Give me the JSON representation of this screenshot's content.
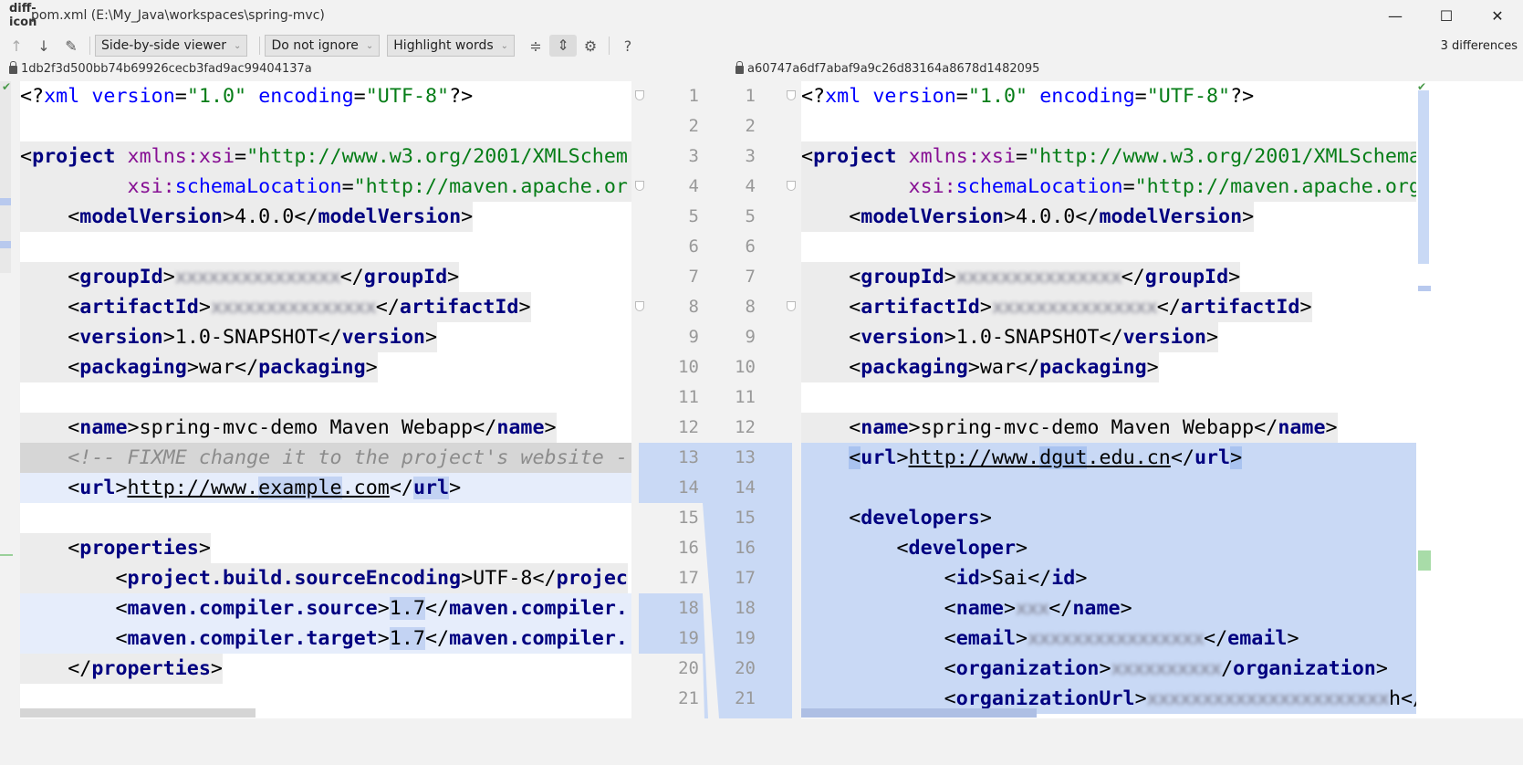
{
  "window": {
    "title": "pom.xml (E:\\My_Java\\workspaces\\spring-mvc)",
    "icon": "diff-icon",
    "minimize": "—",
    "maximize": "☐",
    "close": "✕"
  },
  "toolbar": {
    "prev_icon": "↑",
    "next_icon": "↓",
    "edit_icon": "✎",
    "viewer": "Side-by-side viewer",
    "ignore": "Do not ignore",
    "highlight": "Highlight words",
    "collapse_icon": "≑",
    "sync_scroll_icon": "⇕",
    "settings_icon": "⚙",
    "help_icon": "?",
    "differences": "3 differences"
  },
  "left": {
    "revision": "1db2f3d500bb74b69926cecb3fad9ac99404137a",
    "lines": [
      {
        "n": 1,
        "shade": "none",
        "segs": [
          [
            "p",
            "<?"
          ],
          [
            "a",
            "xml"
          ],
          [
            "p",
            " "
          ],
          [
            "a",
            "version"
          ],
          [
            "p",
            "="
          ],
          [
            "s",
            "\"1.0\""
          ],
          [
            "p",
            " "
          ],
          [
            "a",
            "encoding"
          ],
          [
            "p",
            "="
          ],
          [
            "s",
            "\"UTF-8\""
          ],
          [
            "p",
            "?>"
          ]
        ]
      },
      {
        "n": 2,
        "shade": "none",
        "segs": []
      },
      {
        "n": 3,
        "shade": "fullgray",
        "segs": [
          [
            "p",
            "<"
          ],
          [
            "t",
            "project"
          ],
          [
            "p",
            " "
          ],
          [
            "ns",
            "xmlns:xsi"
          ],
          [
            "p",
            "="
          ],
          [
            "s",
            "\"http://www.w3.org/2001/XMLSchem"
          ]
        ]
      },
      {
        "n": 4,
        "shade": "fullgray",
        "segs": [
          [
            "p",
            "         "
          ],
          [
            "ns",
            "xsi:"
          ],
          [
            "a",
            "schemaLocation"
          ],
          [
            "p",
            "="
          ],
          [
            "s",
            "\"http://maven.apache.or"
          ]
        ]
      },
      {
        "n": 5,
        "shade": "text",
        "segs": [
          [
            "p",
            "    <"
          ],
          [
            "t",
            "modelVersion"
          ],
          [
            "p",
            ">4.0.0</"
          ],
          [
            "t",
            "modelVersion"
          ],
          [
            "p",
            ">"
          ]
        ]
      },
      {
        "n": 6,
        "shade": "none",
        "segs": []
      },
      {
        "n": 7,
        "shade": "text",
        "segs": [
          [
            "p",
            "    <"
          ],
          [
            "t",
            "groupId"
          ],
          [
            "p",
            ">"
          ],
          [
            "b",
            "xxxxxxxxxxxxxxx"
          ],
          [
            "p",
            "</"
          ],
          [
            "t",
            "groupId"
          ],
          [
            "p",
            ">"
          ]
        ]
      },
      {
        "n": 8,
        "shade": "text",
        "segs": [
          [
            "p",
            "    <"
          ],
          [
            "t",
            "artifactId"
          ],
          [
            "p",
            ">"
          ],
          [
            "b",
            "xxxxxxxxxxxxxxx"
          ],
          [
            "p",
            "</"
          ],
          [
            "t",
            "artifactId"
          ],
          [
            "p",
            ">"
          ]
        ]
      },
      {
        "n": 9,
        "shade": "text",
        "segs": [
          [
            "p",
            "    <"
          ],
          [
            "t",
            "version"
          ],
          [
            "p",
            ">1.0-SNAPSHOT</"
          ],
          [
            "t",
            "version"
          ],
          [
            "p",
            ">"
          ]
        ]
      },
      {
        "n": 10,
        "shade": "text",
        "segs": [
          [
            "p",
            "    <"
          ],
          [
            "t",
            "packaging"
          ],
          [
            "p",
            ">war</"
          ],
          [
            "t",
            "packaging"
          ],
          [
            "p",
            ">"
          ]
        ]
      },
      {
        "n": 11,
        "shade": "none",
        "segs": []
      },
      {
        "n": 12,
        "shade": "text",
        "segs": [
          [
            "p",
            "    <"
          ],
          [
            "t",
            "name"
          ],
          [
            "p",
            ">spring-mvc-demo Maven Webapp</"
          ],
          [
            "t",
            "name"
          ],
          [
            "p",
            ">"
          ]
        ]
      },
      {
        "n": 13,
        "shade": "comment",
        "segs": [
          [
            "c",
            "    <!-- FIXME change it to the project's website -"
          ]
        ]
      },
      {
        "n": 14,
        "shade": "changed",
        "segs": [
          [
            "p",
            "    <"
          ],
          [
            "t",
            "url"
          ],
          [
            "p",
            ">"
          ],
          [
            "u",
            "http://www."
          ],
          [
            "uw",
            "example"
          ],
          [
            "u",
            ".com"
          ],
          [
            "p",
            "</"
          ],
          [
            "tw",
            "url"
          ],
          [
            "p",
            ">"
          ]
        ]
      },
      {
        "n": 15,
        "shade": "none",
        "segs": []
      },
      {
        "n": 16,
        "shade": "text",
        "segs": [
          [
            "p",
            "    <"
          ],
          [
            "t",
            "properties"
          ],
          [
            "p",
            ">"
          ]
        ]
      },
      {
        "n": 17,
        "shade": "text",
        "segs": [
          [
            "p",
            "        <"
          ],
          [
            "t",
            "project.build.sourceEncoding"
          ],
          [
            "p",
            ">UTF-8</"
          ],
          [
            "t",
            "projec"
          ]
        ]
      },
      {
        "n": 18,
        "shade": "changed",
        "segs": [
          [
            "p",
            "        <"
          ],
          [
            "t",
            "maven.compiler.source"
          ],
          [
            "p",
            ">"
          ],
          [
            "pw",
            "1.7"
          ],
          [
            "p",
            "</"
          ],
          [
            "t",
            "maven.compiler."
          ]
        ]
      },
      {
        "n": 19,
        "shade": "changed",
        "segs": [
          [
            "p",
            "        <"
          ],
          [
            "t",
            "maven.compiler.target"
          ],
          [
            "p",
            ">"
          ],
          [
            "pw",
            "1.7"
          ],
          [
            "p",
            "</"
          ],
          [
            "t",
            "maven.compiler."
          ]
        ]
      },
      {
        "n": 20,
        "shade": "text",
        "segs": [
          [
            "p",
            "    </"
          ],
          [
            "t",
            "properties"
          ],
          [
            "p",
            ">"
          ]
        ]
      },
      {
        "n": 21,
        "shade": "none",
        "segs": []
      }
    ]
  },
  "right": {
    "revision": "a60747a6df7abaf9a9c26d83164a8678d1482095",
    "lines": [
      {
        "n": 1,
        "shade": "none",
        "segs": [
          [
            "p",
            "<?"
          ],
          [
            "a",
            "xml"
          ],
          [
            "p",
            " "
          ],
          [
            "a",
            "version"
          ],
          [
            "p",
            "="
          ],
          [
            "s",
            "\"1.0\""
          ],
          [
            "p",
            " "
          ],
          [
            "a",
            "encoding"
          ],
          [
            "p",
            "="
          ],
          [
            "s",
            "\"UTF-8\""
          ],
          [
            "p",
            "?>"
          ]
        ]
      },
      {
        "n": 2,
        "shade": "none",
        "segs": []
      },
      {
        "n": 3,
        "shade": "fullgray",
        "segs": [
          [
            "p",
            "<"
          ],
          [
            "t",
            "project"
          ],
          [
            "p",
            " "
          ],
          [
            "ns",
            "xmlns:xsi"
          ],
          [
            "p",
            "="
          ],
          [
            "s",
            "\"http://www.w3.org/2001/XMLSchema-"
          ]
        ]
      },
      {
        "n": 4,
        "shade": "fullgray",
        "segs": [
          [
            "p",
            "         "
          ],
          [
            "ns",
            "xsi:"
          ],
          [
            "a",
            "schemaLocation"
          ],
          [
            "p",
            "="
          ],
          [
            "s",
            "\"http://maven.apache.org"
          ]
        ]
      },
      {
        "n": 5,
        "shade": "text",
        "segs": [
          [
            "p",
            "    <"
          ],
          [
            "t",
            "modelVersion"
          ],
          [
            "p",
            ">4.0.0</"
          ],
          [
            "t",
            "modelVersion"
          ],
          [
            "p",
            ">"
          ]
        ]
      },
      {
        "n": 6,
        "shade": "none",
        "segs": []
      },
      {
        "n": 7,
        "shade": "text",
        "segs": [
          [
            "p",
            "    <"
          ],
          [
            "t",
            "groupId"
          ],
          [
            "p",
            ">"
          ],
          [
            "b",
            "xxxxxxxxxxxxxxx"
          ],
          [
            "p",
            "</"
          ],
          [
            "t",
            "groupId"
          ],
          [
            "p",
            ">"
          ]
        ]
      },
      {
        "n": 8,
        "shade": "text",
        "segs": [
          [
            "p",
            "    <"
          ],
          [
            "t",
            "artifactId"
          ],
          [
            "p",
            ">"
          ],
          [
            "b",
            "xxxxxxxxxxxxxxx"
          ],
          [
            "p",
            "</"
          ],
          [
            "t",
            "artifactId"
          ],
          [
            "p",
            ">"
          ]
        ]
      },
      {
        "n": 9,
        "shade": "text",
        "segs": [
          [
            "p",
            "    <"
          ],
          [
            "t",
            "version"
          ],
          [
            "p",
            ">1.0-SNAPSHOT</"
          ],
          [
            "t",
            "version"
          ],
          [
            "p",
            ">"
          ]
        ]
      },
      {
        "n": 10,
        "shade": "text",
        "segs": [
          [
            "p",
            "    <"
          ],
          [
            "t",
            "packaging"
          ],
          [
            "p",
            ">war</"
          ],
          [
            "t",
            "packaging"
          ],
          [
            "p",
            ">"
          ]
        ]
      },
      {
        "n": 11,
        "shade": "none",
        "segs": []
      },
      {
        "n": 12,
        "shade": "text",
        "segs": [
          [
            "p",
            "    <"
          ],
          [
            "t",
            "name"
          ],
          [
            "p",
            ">spring-mvc-demo Maven Webapp</"
          ],
          [
            "t",
            "name"
          ],
          [
            "p",
            ">"
          ]
        ]
      },
      {
        "n": 13,
        "shade": "inserted",
        "segs": [
          [
            "p",
            "    "
          ],
          [
            "pw2",
            "<"
          ],
          [
            "t",
            "url"
          ],
          [
            "p",
            ">"
          ],
          [
            "u",
            "http://www."
          ],
          [
            "uw2",
            "dgut"
          ],
          [
            "u",
            ".edu.cn"
          ],
          [
            "p",
            "</"
          ],
          [
            "t",
            "url"
          ],
          [
            "pw2",
            ">"
          ]
        ]
      },
      {
        "n": 14,
        "shade": "inserted",
        "segs": []
      },
      {
        "n": 15,
        "shade": "inserted",
        "segs": [
          [
            "p",
            "    <"
          ],
          [
            "t",
            "developers"
          ],
          [
            "p",
            ">"
          ]
        ]
      },
      {
        "n": 16,
        "shade": "inserted",
        "segs": [
          [
            "p",
            "        <"
          ],
          [
            "t",
            "developer"
          ],
          [
            "p",
            ">"
          ]
        ]
      },
      {
        "n": 17,
        "shade": "inserted",
        "segs": [
          [
            "p",
            "            <"
          ],
          [
            "t",
            "id"
          ],
          [
            "p",
            ">Sai</"
          ],
          [
            "t",
            "id"
          ],
          [
            "p",
            ">"
          ]
        ]
      },
      {
        "n": 18,
        "shade": "inserted",
        "segs": [
          [
            "p",
            "            <"
          ],
          [
            "t",
            "name"
          ],
          [
            "p",
            ">"
          ],
          [
            "b",
            "xxx"
          ],
          [
            "p",
            "</"
          ],
          [
            "t",
            "name"
          ],
          [
            "p",
            ">"
          ]
        ]
      },
      {
        "n": 19,
        "shade": "inserted",
        "segs": [
          [
            "p",
            "            <"
          ],
          [
            "t",
            "email"
          ],
          [
            "p",
            ">"
          ],
          [
            "b",
            "xxxxxxxxxxxxxxxx"
          ],
          [
            "p",
            "</"
          ],
          [
            "t",
            "email"
          ],
          [
            "p",
            ">"
          ]
        ]
      },
      {
        "n": 20,
        "shade": "inserted",
        "segs": [
          [
            "p",
            "            <"
          ],
          [
            "t",
            "organization"
          ],
          [
            "p",
            ">"
          ],
          [
            "b",
            "xxxxxxxxxx"
          ],
          [
            "p",
            "/"
          ],
          [
            "t",
            "organization"
          ],
          [
            "p",
            ">"
          ]
        ]
      },
      {
        "n": 21,
        "shade": "inserted",
        "segs": [
          [
            "p",
            "            <"
          ],
          [
            "t",
            "organizationUrl"
          ],
          [
            "p",
            ">"
          ],
          [
            "b",
            "xxxxxxxxxxxxxxxxxxxxxx"
          ],
          [
            "p",
            "h</"
          ]
        ]
      }
    ]
  },
  "colors": {
    "inserted": "#c9d9f5",
    "changed": "#e6edfb",
    "tag": "#000080",
    "string": "#067d17",
    "attr": "#0000ff"
  }
}
